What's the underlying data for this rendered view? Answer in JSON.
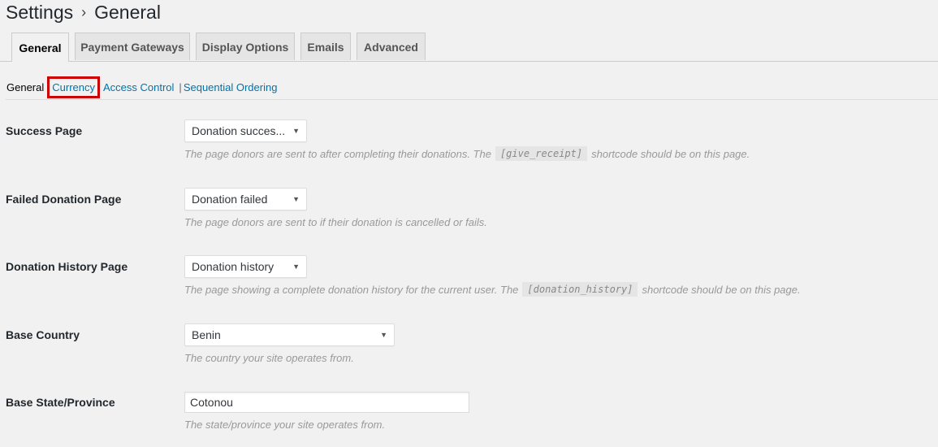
{
  "header": {
    "title_root": "Settings",
    "separator": "›",
    "title_page": "General"
  },
  "tabs": [
    {
      "label": "General"
    },
    {
      "label": "Payment Gateways"
    },
    {
      "label": "Display Options"
    },
    {
      "label": "Emails"
    },
    {
      "label": "Advanced"
    }
  ],
  "subnav": {
    "current": "General",
    "links": [
      "Currency",
      "Access Control",
      "Sequential Ordering"
    ],
    "pipe": "|"
  },
  "fields": {
    "success_page": {
      "label": "Success Page",
      "value": "Donation succes...",
      "desc_before": "The page donors are sent to after completing their donations. The",
      "desc_code": "[give_receipt]",
      "desc_after": "shortcode should be on this page."
    },
    "failed_page": {
      "label": "Failed Donation Page",
      "value": "Donation failed",
      "desc": "The page donors are sent to if their donation is cancelled or fails."
    },
    "history_page": {
      "label": "Donation History Page",
      "value": "Donation history",
      "desc_before": "The page showing a complete donation history for the current user. The",
      "desc_code": "[donation_history]",
      "desc_after": "shortcode should be on this page."
    },
    "base_country": {
      "label": "Base Country",
      "value": "Benin",
      "desc": "The country your site operates from."
    },
    "base_state": {
      "label": "Base State/Province",
      "value": "Cotonou",
      "desc": "The state/province your site operates from."
    }
  },
  "colors": {
    "link": "#0073aa",
    "highlight": "#cc0000",
    "background": "#f1f1f1"
  },
  "icons": {
    "caret": "▼"
  }
}
